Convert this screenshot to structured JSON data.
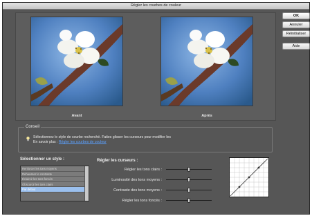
{
  "window": {
    "title": "Régler les courbes de couleur"
  },
  "buttons": {
    "ok": "OK",
    "cancel": "Annuler",
    "reset": "Réinitialiser",
    "help": "Aide"
  },
  "preview": {
    "before_label": "Avant",
    "after_label": "Après"
  },
  "conseil": {
    "title": "Conseil",
    "text": "Sélectionnez le style de courbe recherché. Faites glisser les curseurs pour modifier les",
    "more_prefix": "En savoir plus : ",
    "link": "Régler les courbes de couleur"
  },
  "styles": {
    "title": "Sélectionner un style :",
    "items": [
      "Renforcer les tons moyens",
      "Rehausser le contraste",
      "Éclaircir les tons foncés",
      "Obscurcir les tons clairs",
      "Par défaut"
    ],
    "selected_index": 4
  },
  "cursors": {
    "title": "Régler les curseurs :",
    "sliders": [
      {
        "label": "Régler les tons clairs :",
        "value": 0.5
      },
      {
        "label": "Luminosité des tons moyens :",
        "value": 0.5
      },
      {
        "label": "Contraste des tons moyens :",
        "value": 0.5
      },
      {
        "label": "Régler les tons foncés :",
        "value": 0.5
      }
    ]
  },
  "colors": {
    "accent": "#9bc0ee",
    "link": "#5aa0ff",
    "panel": "#565656"
  },
  "icons": {
    "tip": "lightbulb-icon"
  }
}
